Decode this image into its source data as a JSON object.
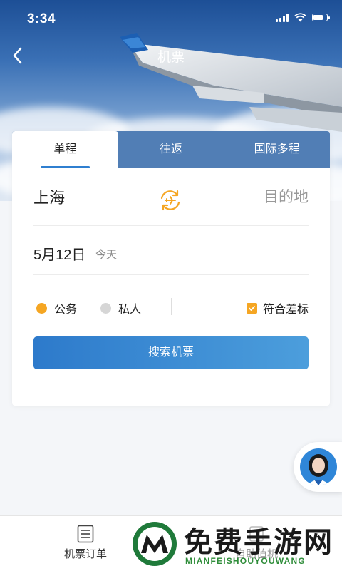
{
  "status_bar": {
    "time": "3:34"
  },
  "nav": {
    "title": "机票"
  },
  "tabs": [
    {
      "label": "单程",
      "active": true
    },
    {
      "label": "往返",
      "active": false
    },
    {
      "label": "国际多程",
      "active": false
    }
  ],
  "route": {
    "from_city": "上海",
    "to_placeholder": "目的地"
  },
  "date": {
    "value": "5月12日",
    "hint": "今天"
  },
  "travel_purpose": {
    "options": [
      {
        "label": "公务",
        "selected": true
      },
      {
        "label": "私人",
        "selected": false
      }
    ],
    "policy_checkbox": {
      "label": "符合差标",
      "checked": true
    }
  },
  "search_button": {
    "label": "搜索机票"
  },
  "bottom_bar": {
    "items": [
      {
        "label": "机票订单",
        "icon": "list-document-icon"
      },
      {
        "label": "自助值机",
        "icon": "checkin-icon"
      }
    ]
  },
  "watermark": {
    "title": "免费手游网",
    "subtitle": "MIANFEISHOUYOUWANG"
  },
  "colors": {
    "accent_blue": "#2f7fd0",
    "orange": "#f5a623",
    "grey_dot": "#d6d6d6",
    "tab_bar": "#205aa0"
  }
}
